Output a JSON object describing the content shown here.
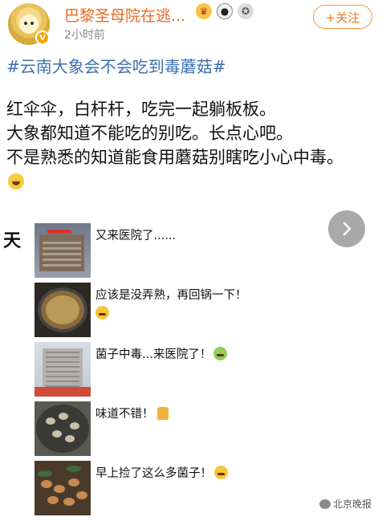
{
  "header": {
    "username": "巴黎圣母院在逃...",
    "timestamp": "2小时前",
    "verified_badge": "V",
    "follow_label": "+关注",
    "badge_icons": [
      "crown-icon",
      "panda-icon",
      "medal-icon"
    ]
  },
  "post": {
    "hashtag": "#云南大象会不会吃到毒蘑菇#",
    "lines": [
      "红伞伞，白杆杆，吃完一起躺板板。",
      "大象都知道不能吃的别吃。长点心吧。",
      "不是熟悉的知道能食用蘑菇别瞎吃小心中毒。"
    ]
  },
  "panel": {
    "edge_text": "天",
    "rows": [
      {
        "caption": "又来医院了......",
        "emoji": ""
      },
      {
        "caption": "应该是没弄熟，再回锅一下！",
        "emoji": "face"
      },
      {
        "caption": "菌子中毒...来医院了！",
        "emoji": "sick-face"
      },
      {
        "caption": "味道不错！",
        "emoji": "thumbs-up"
      },
      {
        "caption": "早上捡了这么多菌子！",
        "emoji": "grin-face"
      }
    ]
  },
  "watermark": "北京晚报",
  "colors": {
    "username": "#e86a22",
    "hashtag": "#3a6fb0",
    "follow": "#e8791d",
    "timestamp": "#8a8a8a"
  }
}
